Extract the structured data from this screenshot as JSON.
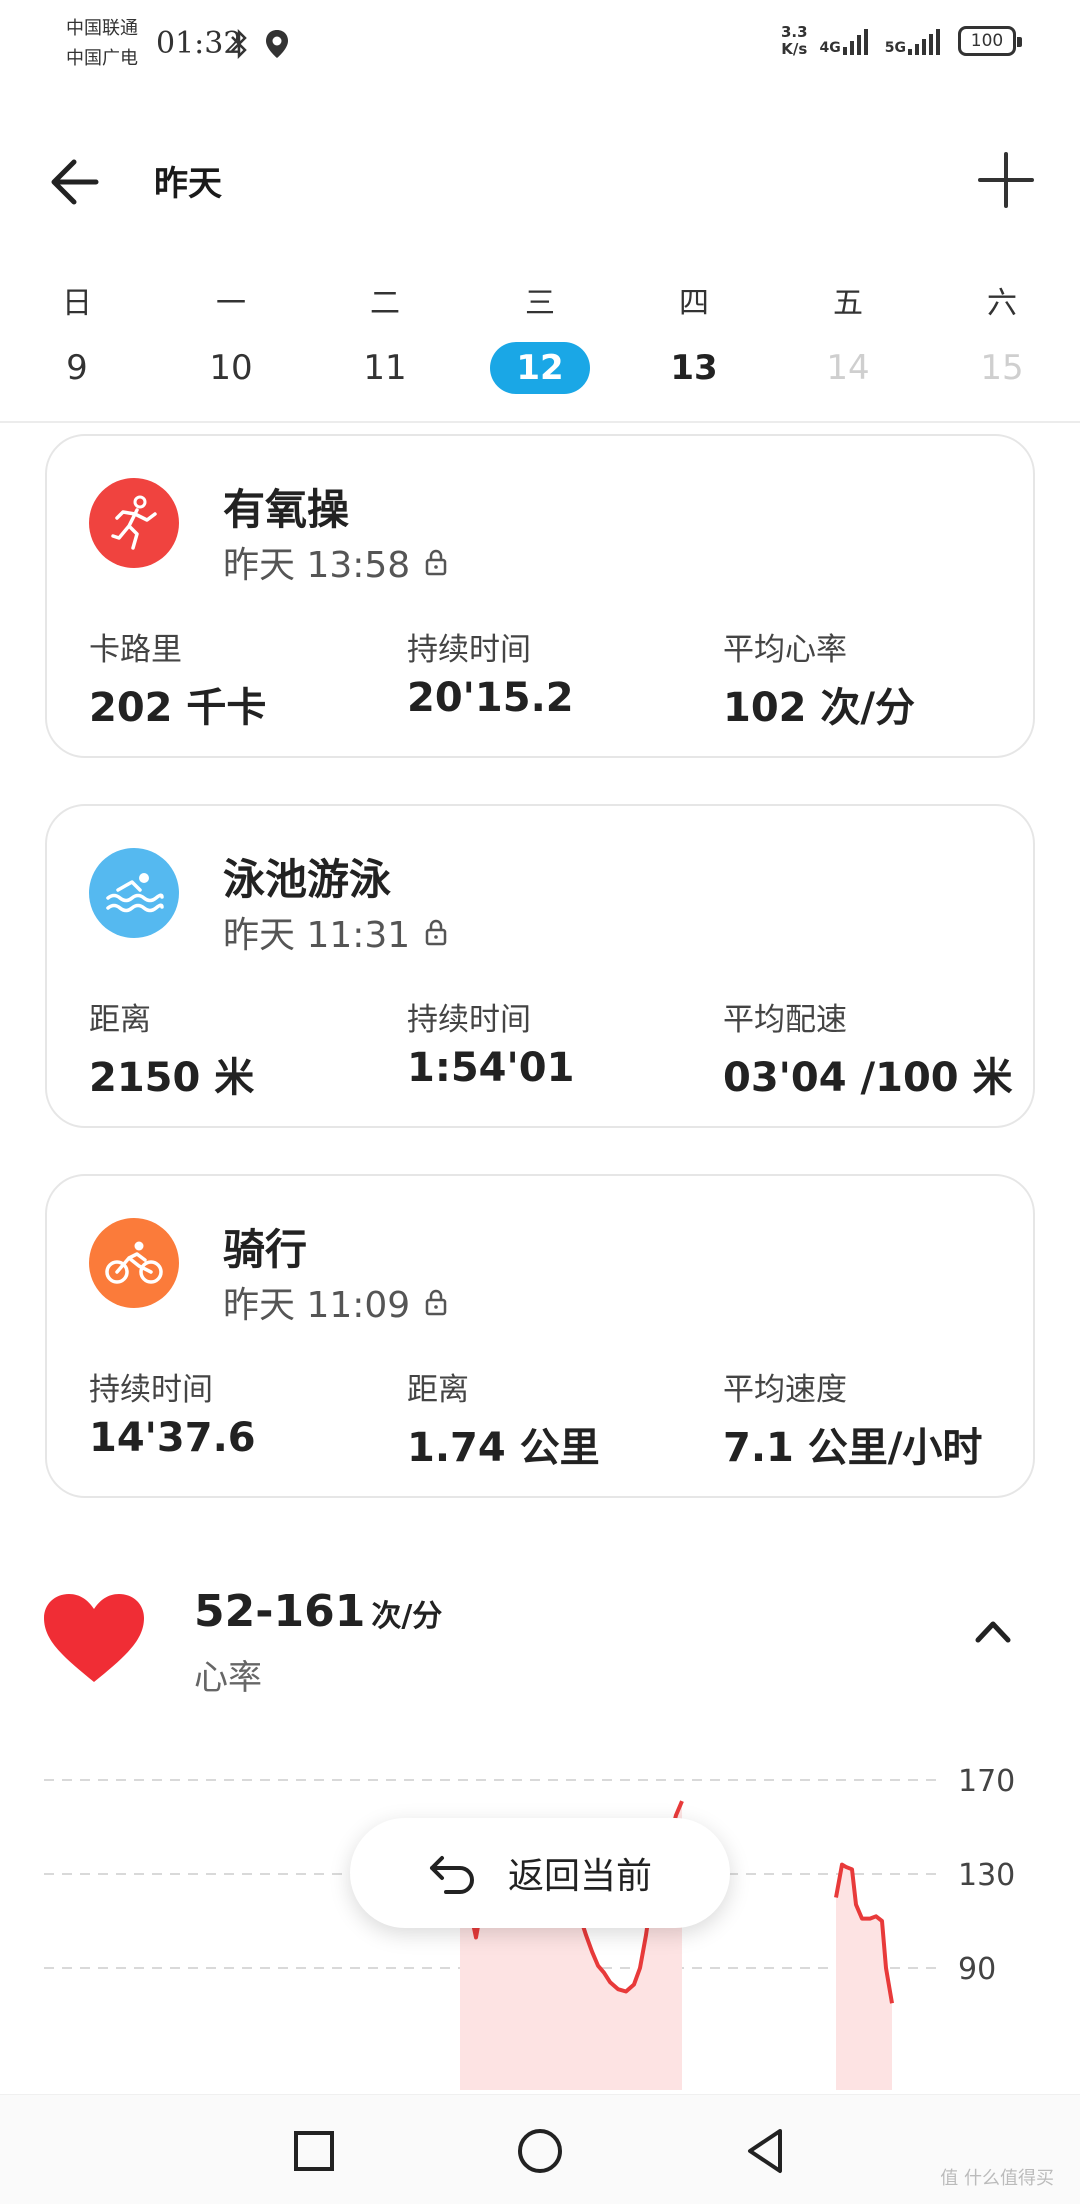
{
  "status_bar": {
    "carrier_1": "中国联通",
    "carrier_2": "中国广电",
    "time": "01:32",
    "net_speed_value": "3.3",
    "net_speed_unit": "K/s",
    "net_4g": "4G",
    "net_5g": "5G",
    "battery": "100"
  },
  "header": {
    "title": "昨天"
  },
  "week": [
    {
      "label": "日",
      "num": "9",
      "state": "normal"
    },
    {
      "label": "一",
      "num": "10",
      "state": "normal"
    },
    {
      "label": "二",
      "num": "11",
      "state": "normal"
    },
    {
      "label": "三",
      "num": "12",
      "state": "selected"
    },
    {
      "label": "四",
      "num": "13",
      "state": "bold"
    },
    {
      "label": "五",
      "num": "14",
      "state": "future"
    },
    {
      "label": "六",
      "num": "15",
      "state": "future"
    }
  ],
  "workouts": [
    {
      "title": "有氧操",
      "time": "昨天 13:58",
      "icon": "aerobics-icon",
      "color": "#f0433f",
      "stats": [
        {
          "label": "卡路里",
          "value": "202 千卡"
        },
        {
          "label": "持续时间",
          "value": "20'15.2"
        },
        {
          "label": "平均心率",
          "value": "102 次/分"
        }
      ]
    },
    {
      "title": "泳池游泳",
      "time": "昨天 11:31",
      "icon": "swimming-icon",
      "color": "#55b9f0",
      "stats": [
        {
          "label": "距离",
          "value": "2150 米"
        },
        {
          "label": "持续时间",
          "value": "1:54'01"
        },
        {
          "label": "平均配速",
          "value": "03'04 /100 米"
        }
      ]
    },
    {
      "title": "骑行",
      "time": "昨天 11:09",
      "icon": "cycling-icon",
      "color": "#fb7b3a",
      "stats": [
        {
          "label": "持续时间",
          "value": "14'37.6"
        },
        {
          "label": "距离",
          "value": "1.74 公里"
        },
        {
          "label": "平均速度",
          "value": "7.1 公里/小时"
        }
      ]
    }
  ],
  "heart_rate": {
    "range": "52-161",
    "unit": "次/分",
    "label": "心率"
  },
  "chart_data": {
    "type": "line",
    "y_ticks": [
      "170",
      "130",
      "90"
    ],
    "ylim": [
      60,
      175
    ],
    "series": [
      {
        "values": [
          [
            460,
            118
          ],
          [
            468,
            119
          ],
          [
            476,
            103
          ],
          [
            484,
            122
          ],
          [
            492,
            128
          ],
          [
            500,
            139
          ],
          [
            510,
            132
          ],
          [
            518,
            125
          ],
          [
            524,
            118
          ],
          [
            532,
            130
          ],
          [
            540,
            125
          ],
          [
            548,
            127
          ],
          [
            556,
            122
          ],
          [
            564,
            126
          ],
          [
            572,
            122
          ],
          [
            580,
            112
          ],
          [
            586,
            104
          ],
          [
            592,
            97
          ],
          [
            598,
            91
          ],
          [
            604,
            88
          ],
          [
            610,
            84
          ],
          [
            618,
            81
          ],
          [
            626,
            80
          ],
          [
            634,
            83
          ],
          [
            640,
            90
          ],
          [
            646,
            104
          ],
          [
            652,
            122
          ],
          [
            658,
            128
          ],
          [
            664,
            135
          ],
          [
            670,
            145
          ],
          [
            676,
            155
          ],
          [
            682,
            161
          ]
        ]
      },
      {
        "values": [
          [
            836,
            120
          ],
          [
            842,
            134
          ],
          [
            846,
            133
          ],
          [
            852,
            132
          ],
          [
            856,
            117
          ],
          [
            862,
            111
          ],
          [
            870,
            111
          ],
          [
            876,
            112
          ],
          [
            882,
            110
          ],
          [
            886,
            90
          ],
          [
            892,
            75
          ]
        ]
      }
    ],
    "grid": true
  },
  "return_button": {
    "label": "返回当前"
  },
  "watermark": "值 什么值得买"
}
